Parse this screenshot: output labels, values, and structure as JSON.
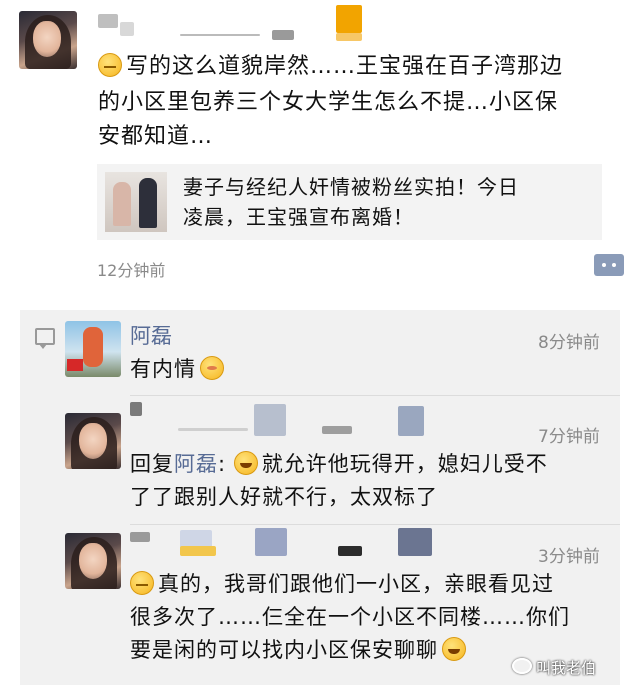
{
  "post": {
    "text_line1": "写的这么道貌岸然……王宝强在百子湾那边",
    "text_line2": "的小区里包养三个女大学生怎么不提…小区保",
    "text_line3": "安都知道…",
    "time": "12分钟前",
    "link_title_line1": "妻子与经纪人奸情被粉丝实拍！今日",
    "link_title_line2": "凌晨，王宝强宣布离婚！"
  },
  "comments": [
    {
      "name": "阿磊",
      "time": "8分钟前",
      "text": "有内情"
    },
    {
      "reply_prefix": "回复",
      "reply_to": "阿磊",
      "time": "7分钟前",
      "text_line1": "就允许他玩得开，媳妇儿受不",
      "text_line2": "了了跟别人好就不行，太双标了"
    },
    {
      "time": "3分钟前",
      "text_line1": "真的，我哥们跟他们一小区，亲眼看见过",
      "text_line2": "很多次了……仨全在一个小区不同楼……你们",
      "text_line3": "要是闲的可以找内小区保安聊聊"
    }
  ],
  "watermark": "叫我老伯",
  "colors": {
    "name_link": "#576b95",
    "time": "#8a8a8a",
    "comment_bg": "#f1f1f1"
  }
}
